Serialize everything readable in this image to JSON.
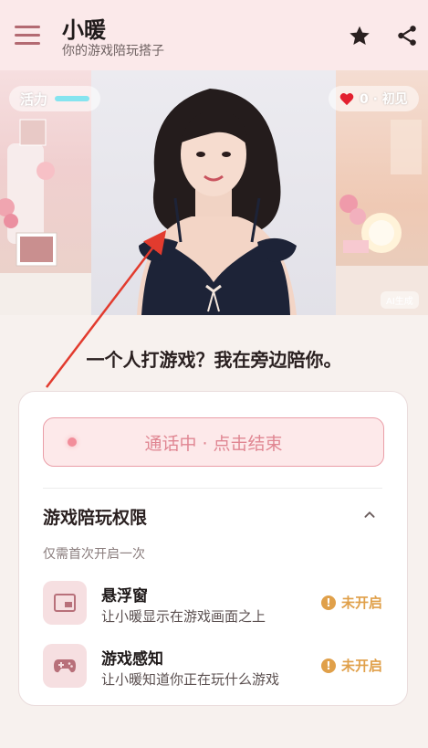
{
  "header": {
    "title": "小暖",
    "subtitle": "你的游戏陪玩搭子",
    "menu_icon": "hamburger-icon",
    "star_icon": "star-icon",
    "share_icon": "share-icon"
  },
  "hero": {
    "vitality_label": "活力",
    "vitality_level": 0.7,
    "affinity_text": "0 · 初见",
    "ai_tag": "AI生成"
  },
  "tagline": "一个人打游戏？我在旁边陪你。",
  "call": {
    "label": "通话中 · 点击结束"
  },
  "permissions": {
    "title": "游戏陪玩权限",
    "hint": "仅需首次开启一次",
    "items": [
      {
        "name": "悬浮窗",
        "desc": "让小暖显示在游戏画面之上",
        "status": "未开启",
        "icon": "floating-window-icon"
      },
      {
        "name": "游戏感知",
        "desc": "让小暖知道你正在玩什么游戏",
        "status": "未开启",
        "icon": "gamepad-icon"
      }
    ]
  },
  "colors": {
    "accent": "#e08692",
    "warning": "#e0a04a",
    "header_bg": "#fbe9ea",
    "arrow": "#e23b2e"
  }
}
